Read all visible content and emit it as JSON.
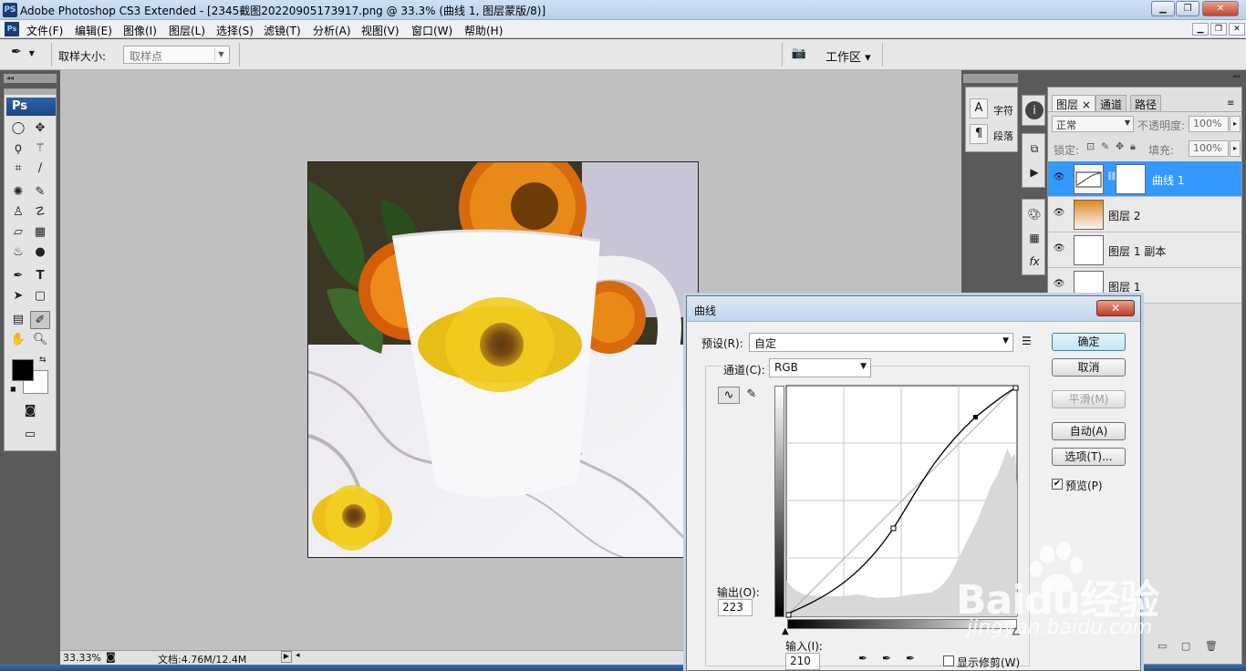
{
  "window": {
    "app_icon": "PS",
    "title": "Adobe Photoshop CS3 Extended - [2345截图20220905173917.png @ 33.3% (曲线 1, 图层蒙版/8)]",
    "controls": [
      "minimize-icon",
      "maximize-icon",
      "close-icon"
    ]
  },
  "menu": {
    "doc_icon": "Ps",
    "items": [
      "文件(F)",
      "编辑(E)",
      "图像(I)",
      "图层(L)",
      "选择(S)",
      "滤镜(T)",
      "分析(A)",
      "视图(V)",
      "窗口(W)",
      "帮助(H)"
    ]
  },
  "options": {
    "sample_size_label": "取样大小:",
    "sample_size_value": "取样点",
    "workspace_label": "工作区 ▾"
  },
  "toolbox": {
    "logo": "Ps"
  },
  "status": {
    "zoom": "33.33%",
    "doc_info": "文档:4.76M/12.4M"
  },
  "char_panel": {
    "character": "字符",
    "paragraph": "段落"
  },
  "layers_panel": {
    "tabs": [
      "图层",
      "通道",
      "路径"
    ],
    "blend_mode": "正常",
    "opacity_label": "不透明度:",
    "opacity_value": "100%",
    "lock_label": "锁定:",
    "fill_label": "填充:",
    "fill_value": "100%",
    "layers": [
      {
        "name": "曲线 1",
        "selected": true
      },
      {
        "name": "图层 2",
        "selected": false
      },
      {
        "name": "图层 1 副本",
        "selected": false
      },
      {
        "name": "图层 1",
        "selected": false
      }
    ]
  },
  "curves_dialog": {
    "title": "曲线",
    "preset_label": "预设(R):",
    "preset_value": "自定",
    "channel_label": "通道(C):",
    "channel_value": "RGB",
    "output_label": "输出(O):",
    "output_value": "223",
    "input_label": "输入(I):",
    "input_value": "210",
    "show_clipping_label": "显示修剪(W)",
    "buttons": {
      "ok": "确定",
      "cancel": "取消",
      "smooth": "平滑(M)",
      "auto": "自动(A)",
      "options": "选项(T)..."
    },
    "preview_label": "预览(P)",
    "preview_checked": true
  },
  "watermark": {
    "text": "Baidu经验",
    "url": "jingyan.baidu.com"
  }
}
